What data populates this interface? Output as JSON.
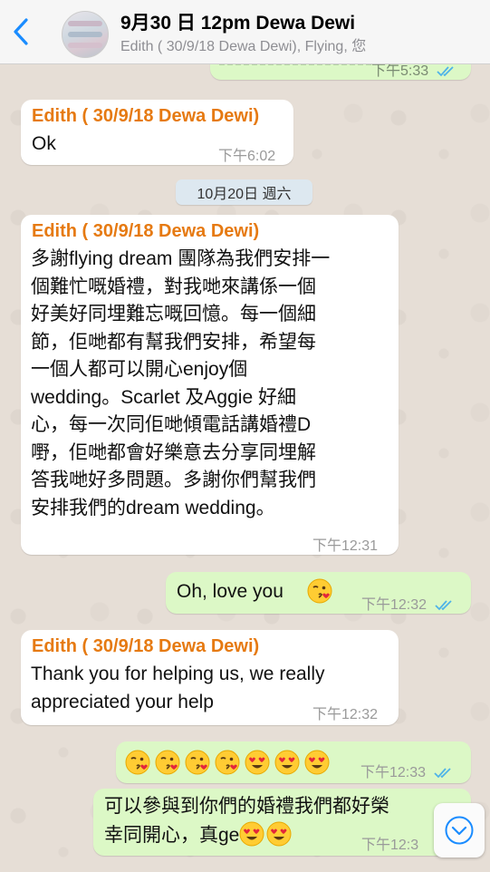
{
  "header": {
    "title": "9月30 日 12pm Dewa Dewi",
    "subtitle": "Edith ( 30/9/18 Dewa Dewi), Flying, 您"
  },
  "date_separator": "10月20日 週六",
  "messages": [
    {
      "id": "m0",
      "direction": "out",
      "text": "",
      "time": "下午5:33",
      "read": true
    },
    {
      "id": "m1",
      "direction": "in",
      "sender": "Edith ( 30/9/18 Dewa Dewi)",
      "text": "Ok",
      "time": "下午6:02"
    },
    {
      "id": "m2",
      "direction": "in",
      "sender": "Edith ( 30/9/18 Dewa Dewi)",
      "lines": [
        "多謝flying dream 團隊為我們安排一",
        "個難忙嘅婚禮，對我哋來講係一個",
        "好美好同埋難忘嘅回憶。每一個細",
        "節，佢哋都有幫我們安排，希望每",
        "一個人都可以開心enjoy個",
        "wedding。Scarlet 及Aggie 好細",
        "心，每一次同佢哋傾電話講婚禮D",
        "嘢，佢哋都會好樂意去分享同埋解",
        "答我哋好多問題。多謝你們幫我們",
        "安排我們的dream wedding。"
      ],
      "time": "下午12:31"
    },
    {
      "id": "m3",
      "direction": "out",
      "text": "Oh, love you",
      "emoji": [
        "kiss-wink"
      ],
      "time": "下午12:32",
      "read": true
    },
    {
      "id": "m4",
      "direction": "in",
      "sender": "Edith ( 30/9/18 Dewa Dewi)",
      "lines": [
        "Thank you for helping us, we really",
        "appreciated your help"
      ],
      "time": "下午12:32"
    },
    {
      "id": "m5",
      "direction": "out",
      "emoji": [
        "kiss-wink",
        "kiss-wink",
        "kiss-wink",
        "kiss-wink",
        "heart-eyes",
        "heart-eyes",
        "heart-eyes"
      ],
      "time": "下午12:33",
      "read": true
    },
    {
      "id": "m6",
      "direction": "out",
      "lines": [
        "可以參與到你們的婚禮我們都好榮",
        "幸同開心，真ge"
      ],
      "emoji": [
        "heart-eyes",
        "heart-eyes"
      ],
      "time": "下午12:3"
    }
  ],
  "icons": {
    "back": "chevron-left-icon",
    "scroll_down": "chevron-down-circle-icon",
    "read_receipt": "double-check-icon"
  },
  "colors": {
    "sender_name": "#e67a12",
    "outgoing_bubble": "#dcf8c6",
    "incoming_bubble": "#ffffff",
    "read_tick": "#4fb3e8",
    "ios_blue": "#1a8cff"
  }
}
